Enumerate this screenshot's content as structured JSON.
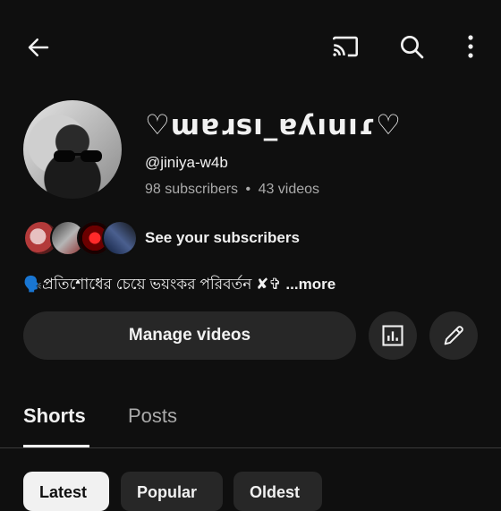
{
  "header": {
    "back_icon": "arrow-left-icon",
    "cast_icon": "cast-icon",
    "search_icon": "search-icon",
    "more_icon": "more-vertical-icon"
  },
  "channel": {
    "name": "♡ɯɐɹsı_ɐʎıuıɾ♡",
    "handle": "@jiniya-w4b",
    "subscribers": "98 subscribers",
    "separator": "•",
    "videos": "43 videos",
    "see_subscribers": "See your subscribers",
    "description": "🗣️প্রতিশোধের চেয়ে ভয়ংকর পরিবর্তন ✘✞",
    "more": "...more"
  },
  "actions": {
    "manage_videos": "Manage videos",
    "analytics_icon": "analytics-icon",
    "edit_icon": "pencil-icon"
  },
  "tabs": [
    {
      "label": "Shorts",
      "active": true
    },
    {
      "label": "Posts",
      "active": false
    }
  ],
  "chips": [
    {
      "label": "Latest",
      "active": true
    },
    {
      "label": "Popular",
      "active": false
    },
    {
      "label": "Oldest",
      "active": false
    }
  ],
  "colors": {
    "background": "#0f0f0f",
    "surface": "#272727",
    "text": "#f1f1f1",
    "secondary_text": "#aaaaaa"
  }
}
